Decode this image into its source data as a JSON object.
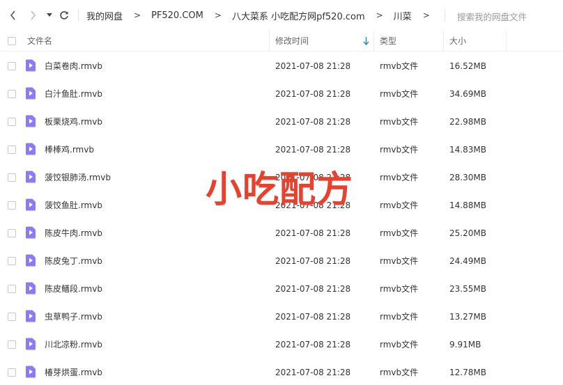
{
  "nav": {
    "back_icon": "chevron-left-icon",
    "forward_icon": "chevron-right-icon",
    "dropdown_icon": "caret-down-icon",
    "refresh_icon": "refresh-icon"
  },
  "breadcrumb": {
    "items": [
      "我的网盘",
      "PF520.COM",
      "八大菜系 小吃配方网pf520.com",
      "川菜"
    ],
    "separator": ">"
  },
  "search": {
    "placeholder": "搜索我的网盘文件"
  },
  "columns": {
    "name": "文件名",
    "modified": "修改时间",
    "type": "类型",
    "size": "大小",
    "sort_icon": "arrow-down-icon"
  },
  "files": [
    {
      "name": "白菜卷肉.rmvb",
      "modified": "2021-07-08 21:28",
      "type": "rmvb文件",
      "size": "16.52MB"
    },
    {
      "name": "白汁鱼肚.rmvb",
      "modified": "2021-07-08 21:28",
      "type": "rmvb文件",
      "size": "34.69MB"
    },
    {
      "name": "板栗烧鸡.rmvb",
      "modified": "2021-07-08 21:28",
      "type": "rmvb文件",
      "size": "22.98MB"
    },
    {
      "name": "棒棒鸡.rmvb",
      "modified": "2021-07-08 21:28",
      "type": "rmvb文件",
      "size": "14.83MB"
    },
    {
      "name": "菠饺银肺汤.rmvb",
      "modified": "2021-07-08 21:28",
      "type": "rmvb文件",
      "size": "28.30MB"
    },
    {
      "name": "菠饺鱼肚.rmvb",
      "modified": "2021-07-08 21:28",
      "type": "rmvb文件",
      "size": "14.88MB"
    },
    {
      "name": "陈皮牛肉.rmvb",
      "modified": "2021-07-08 21:28",
      "type": "rmvb文件",
      "size": "25.20MB"
    },
    {
      "name": "陈皮兔丁.rmvb",
      "modified": "2021-07-08 21:28",
      "type": "rmvb文件",
      "size": "24.49MB"
    },
    {
      "name": "陈皮鳝段.rmvb",
      "modified": "2021-07-08 21:28",
      "type": "rmvb文件",
      "size": "23.55MB"
    },
    {
      "name": "虫草鸭子.rmvb",
      "modified": "2021-07-08 21:28",
      "type": "rmvb文件",
      "size": "13.27MB"
    },
    {
      "name": "川北凉粉.rmvb",
      "modified": "2021-07-08 21:28",
      "type": "rmvb文件",
      "size": "9.91MB"
    },
    {
      "name": "椿芽烘蛋.rmvb",
      "modified": "2021-07-08 21:28",
      "type": "rmvb文件",
      "size": "12.78MB"
    }
  ],
  "file_icon": "video-file-icon",
  "watermark": {
    "text": "小吃配方"
  },
  "colors": {
    "file_icon": "#8a7cf2",
    "watermark": "#e8412e",
    "sort_arrow": "#1a8cf0"
  }
}
